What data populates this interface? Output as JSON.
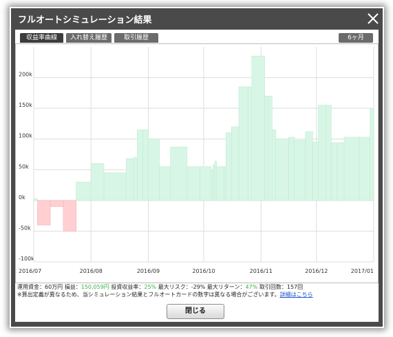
{
  "window": {
    "title": "フルオートシミュレーション結果"
  },
  "tabs": [
    {
      "label": "収益率曲線",
      "active": true
    },
    {
      "label": "入れ替え履歴",
      "active": false
    },
    {
      "label": "取引履歴",
      "active": false
    }
  ],
  "period": {
    "label": "6ヶ月"
  },
  "summary": {
    "capital": "運用資金：60万円",
    "profit_label": "損益：",
    "profit_value": "150,059円",
    "yield_label": "投資収益率：",
    "yield_value": "25%",
    "max_risk": "最大リスク：-29%",
    "max_return_label": "最大リターン：",
    "max_return_value": "47%",
    "trades": "取引回数：157回"
  },
  "note": {
    "text": "※算出定義が異なるため、当シミュレーション結果とフルオートカードの数字は異なる場合がございます。",
    "link": "詳細はこちら"
  },
  "buttons": {
    "close_label": "閉じる"
  },
  "colors": {
    "positive_fill": "#d8f6e6",
    "negative_fill": "#ffcfd2",
    "titlebar": "#4a4a4a"
  },
  "chart_data": {
    "type": "area",
    "title": "",
    "xlabel": "",
    "ylabel": "",
    "x_tick_labels": [
      "2016/07",
      "2016/08",
      "2016/09",
      "2016/10",
      "2016/11",
      "2016/12",
      "2017/01"
    ],
    "y_tick_labels": [
      "-100k",
      "-50k",
      "0k",
      "50k",
      "100k",
      "150k",
      "200k"
    ],
    "ylim": [
      -100000,
      250000
    ],
    "xlim": [
      "2016-07-01",
      "2017-01-01"
    ],
    "grid": true,
    "series": [
      {
        "x": [
          "2016-07-01",
          "2016-07-03",
          "2016-07-10",
          "2016-07-17",
          "2016-07-24",
          "2016-08-01",
          "2016-08-08",
          "2016-08-20",
          "2016-08-24",
          "2016-08-26",
          "2016-08-29",
          "2016-09-01",
          "2016-09-07",
          "2016-09-13",
          "2016-09-22",
          "2016-09-29",
          "2016-10-05",
          "2016-10-06",
          "2016-10-07",
          "2016-10-08",
          "2016-10-12",
          "2016-10-13",
          "2016-10-16",
          "2016-10-20",
          "2016-10-25",
          "2016-10-27",
          "2016-11-03",
          "2016-11-05",
          "2016-11-07",
          "2016-11-09",
          "2016-11-16",
          "2016-11-19",
          "2016-11-25",
          "2016-11-29",
          "2016-12-02",
          "2016-12-06",
          "2016-12-09",
          "2016-12-12",
          "2016-12-16",
          "2016-12-24",
          "2016-12-30"
        ],
        "values": [
          3000,
          -40000,
          -10000,
          -50000,
          30000,
          60000,
          45000,
          68000,
          70000,
          115000,
          115000,
          100000,
          55000,
          87000,
          55000,
          55000,
          50000,
          58000,
          64000,
          55000,
          55000,
          110000,
          120000,
          185000,
          185000,
          235000,
          170000,
          170000,
          115000,
          100000,
          103000,
          98000,
          112000,
          95000,
          155000,
          155000,
          94000,
          94000,
          103000,
          103000,
          150000
        ]
      }
    ]
  }
}
